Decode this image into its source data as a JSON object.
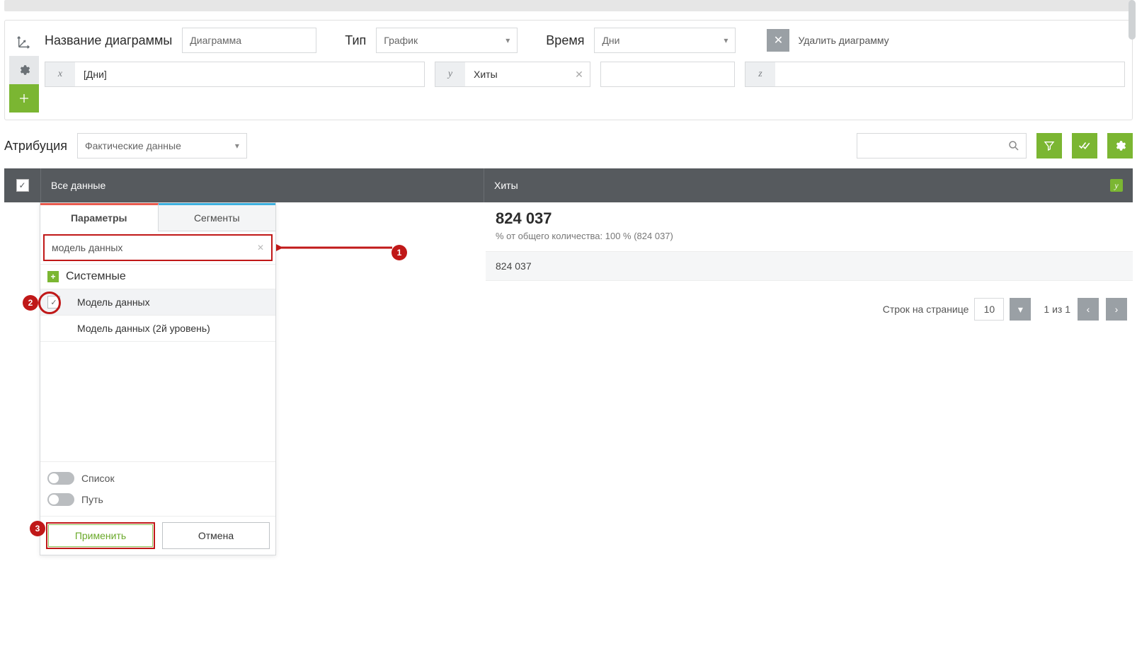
{
  "chart": {
    "title_label": "Название диаграммы",
    "title_value": "Диаграмма",
    "type_label": "Тип",
    "type_value": "График",
    "time_label": "Время",
    "time_value": "Дни",
    "delete_label": "Удалить диаграмму",
    "axes": {
      "x": {
        "var": "x",
        "value": "[Дни]"
      },
      "y": {
        "var": "y",
        "value": "Хиты"
      },
      "y2": {
        "var": "",
        "value": ""
      },
      "z": {
        "var": "z",
        "value": ""
      }
    }
  },
  "attribution": {
    "label": "Атрибуция",
    "value": "Фактические данные"
  },
  "table": {
    "col_all": "Все данные",
    "col_metric": "Хиты"
  },
  "summary": {
    "value": "824 037",
    "subtext": "% от общего количества: 100 % (824 037)",
    "row_value": "824 037"
  },
  "dropdown": {
    "tab_params": "Параметры",
    "tab_segments": "Сегменты",
    "search_value": "модель данных",
    "group": "Системные",
    "item1": "Модель данных",
    "item2": "Модель данных (2й уровень)",
    "toggle_list": "Список",
    "toggle_path": "Путь",
    "apply": "Применить",
    "cancel": "Отмена"
  },
  "markers": {
    "m1": "1",
    "m2": "2",
    "m3": "3"
  },
  "footer": {
    "rows_label": "Строк на странице",
    "rows_value": "10",
    "page_text": "1 из 1"
  }
}
